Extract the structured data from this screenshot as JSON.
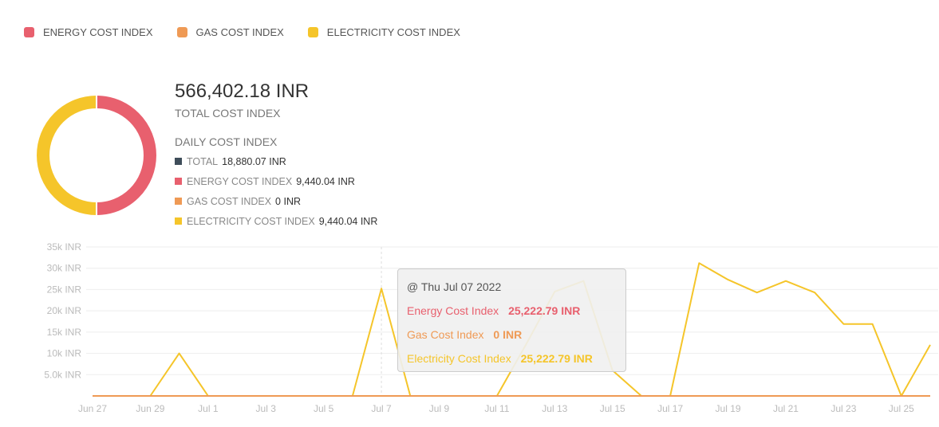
{
  "legend": [
    {
      "label": "ENERGY COST INDEX",
      "color": "#e8606e"
    },
    {
      "label": "GAS COST INDEX",
      "color": "#ef9a55"
    },
    {
      "label": "ELECTRICITY COST INDEX",
      "color": "#f5c52a"
    }
  ],
  "summary": {
    "total_value": "566,402.18 INR",
    "total_label": "TOTAL COST INDEX",
    "daily_label": "DAILY COST INDEX",
    "daily": [
      {
        "name": "TOTAL",
        "value": "18,880.07 INR",
        "color": "#3f4d5a"
      },
      {
        "name": "ENERGY COST INDEX",
        "value": "9,440.04 INR",
        "color": "#e8606e"
      },
      {
        "name": "GAS COST INDEX",
        "value": "0 INR",
        "color": "#ef9a55"
      },
      {
        "name": "ELECTRICITY COST INDEX",
        "value": "9,440.04 INR",
        "color": "#f5c52a"
      }
    ]
  },
  "donut": {
    "slices": [
      {
        "name": "ENERGY COST INDEX",
        "share": 0.5,
        "color": "#e8606e"
      },
      {
        "name": "ELECTRICITY COST INDEX",
        "share": 0.5,
        "color": "#f5c52a"
      }
    ]
  },
  "tooltip": {
    "date": "@ Thu Jul 07 2022",
    "rows": [
      {
        "name": "Energy Cost Index",
        "value": "25,222.79 INR",
        "color": "#e8606e"
      },
      {
        "name": "Gas Cost Index",
        "value": "0 INR",
        "color": "#ef9a55"
      },
      {
        "name": "Electricity Cost Index",
        "value": "25,222.79 INR",
        "color": "#f5c52a"
      }
    ]
  },
  "chart_data": {
    "type": "line",
    "x_labels": [
      "Jun 27",
      "Jun 29",
      "Jul 1",
      "Jul 3",
      "Jul 5",
      "Jul 7",
      "Jul 9",
      "Jul 11",
      "Jul 13",
      "Jul 15",
      "Jul 17",
      "Jul 19",
      "Jul 21",
      "Jul 23",
      "Jul 25"
    ],
    "x": [
      "Jun 27",
      "Jun 28",
      "Jun 29",
      "Jun 30",
      "Jul 1",
      "Jul 2",
      "Jul 3",
      "Jul 4",
      "Jul 5",
      "Jul 6",
      "Jul 7",
      "Jul 8",
      "Jul 9",
      "Jul 10",
      "Jul 11",
      "Jul 12",
      "Jul 13",
      "Jul 14",
      "Jul 15",
      "Jul 16",
      "Jul 17",
      "Jul 18",
      "Jul 19",
      "Jul 20",
      "Jul 21",
      "Jul 22",
      "Jul 23",
      "Jul 24",
      "Jul 25",
      "Jul 26"
    ],
    "y_ticks": [
      "5.0k INR",
      "10k INR",
      "15k INR",
      "20k INR",
      "25k INR",
      "30k INR",
      "35k INR"
    ],
    "ylim": [
      0,
      35000
    ],
    "series": [
      {
        "name": "Electricity Cost Index",
        "color": "#f5c52a",
        "values": [
          0,
          0,
          0,
          10000,
          0,
          0,
          0,
          0,
          0,
          0,
          25222.79,
          0,
          0,
          0,
          0,
          12000,
          24500,
          27000,
          6000,
          0,
          0,
          31200,
          27300,
          24300,
          27000,
          24300,
          16900,
          16900,
          0,
          12000
        ]
      },
      {
        "name": "Gas Cost Index",
        "color": "#ef9a55",
        "values": [
          0,
          0,
          0,
          0,
          0,
          0,
          0,
          0,
          0,
          0,
          0,
          0,
          0,
          0,
          0,
          0,
          0,
          0,
          0,
          0,
          0,
          0,
          0,
          0,
          0,
          0,
          0,
          0,
          0,
          0
        ]
      }
    ],
    "highlight": "Jul 7"
  }
}
